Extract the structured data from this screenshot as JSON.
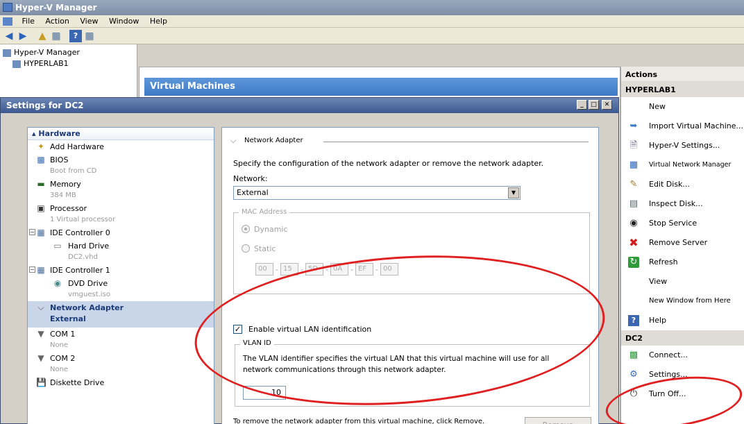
{
  "window": {
    "title": "Hyper-V Manager"
  },
  "menu": [
    "File",
    "Action",
    "View",
    "Window",
    "Help"
  ],
  "tree": {
    "root": "Hyper-V Manager",
    "server": "HYPERLAB1"
  },
  "center": {
    "header": "Virtual Machines"
  },
  "actions": {
    "header": "Actions",
    "server_section": "HYPERLAB1",
    "server_items": [
      {
        "label": "New",
        "icon": "none"
      },
      {
        "label": "Import Virtual Machine...",
        "icon": "import-icon"
      },
      {
        "label": "Hyper-V Settings...",
        "icon": "settings-doc-icon"
      },
      {
        "label": "Virtual Network Manager",
        "icon": "network-manager-icon"
      },
      {
        "label": "Edit Disk...",
        "icon": "edit-disk-icon"
      },
      {
        "label": "Inspect Disk...",
        "icon": "inspect-disk-icon"
      },
      {
        "label": "Stop Service",
        "icon": "stop-icon"
      },
      {
        "label": "Remove Server",
        "icon": "remove-x-icon"
      },
      {
        "label": "Refresh",
        "icon": "refresh-icon"
      },
      {
        "label": "View",
        "icon": "none"
      },
      {
        "label": "New Window from Here",
        "icon": "none"
      },
      {
        "label": "Help",
        "icon": "help-icon"
      }
    ],
    "vm_section": "DC2",
    "vm_items": [
      {
        "label": "Connect...",
        "icon": "connect-icon"
      },
      {
        "label": "Settings...",
        "icon": "settings-icon"
      },
      {
        "label": "Turn Off...",
        "icon": "turn-off-icon"
      }
    ]
  },
  "dialog": {
    "title": "Settings for DC2",
    "hardware_header": "Hardware",
    "hardware": {
      "add_hardware": "Add Hardware",
      "bios": "BIOS",
      "bios_sub": "Boot from CD",
      "memory": "Memory",
      "memory_sub": "384 MB",
      "processor": "Processor",
      "processor_sub": "1 Virtual processor",
      "ide0": "IDE Controller 0",
      "hard_drive": "Hard Drive",
      "hard_drive_sub": "DC2.vhd",
      "ide1": "IDE Controller 1",
      "dvd": "DVD Drive",
      "dvd_sub": "vmguest.iso",
      "net_adapter": "Network Adapter",
      "net_adapter_sub": "External",
      "com1": "COM 1",
      "com1_sub": "None",
      "com2": "COM 2",
      "com2_sub": "None",
      "diskette": "Diskette Drive"
    },
    "detail": {
      "section": "Network Adapter",
      "description": "Specify the configuration of the network adapter or remove the network adapter.",
      "network_label": "Network:",
      "network_value": "External",
      "mac_legend": "MAC Address",
      "dynamic": "Dynamic",
      "static": "Static",
      "mac": [
        "00",
        "15",
        "5D",
        "0A",
        "EF",
        "00"
      ],
      "vlan_enable": "Enable virtual LAN identification",
      "vlan_legend": "VLAN ID",
      "vlan_desc_1": "The VLAN identifier specifies the virtual LAN that this virtual machine will use for all",
      "vlan_desc_2": "network communications through this network adapter.",
      "vlan_value": "10",
      "remove_text": "To remove the network adapter from this virtual machine, click Remove.",
      "remove_button": "Remove"
    }
  },
  "colors": {
    "annotation": "#e02020",
    "accent": "#3e79c6"
  }
}
